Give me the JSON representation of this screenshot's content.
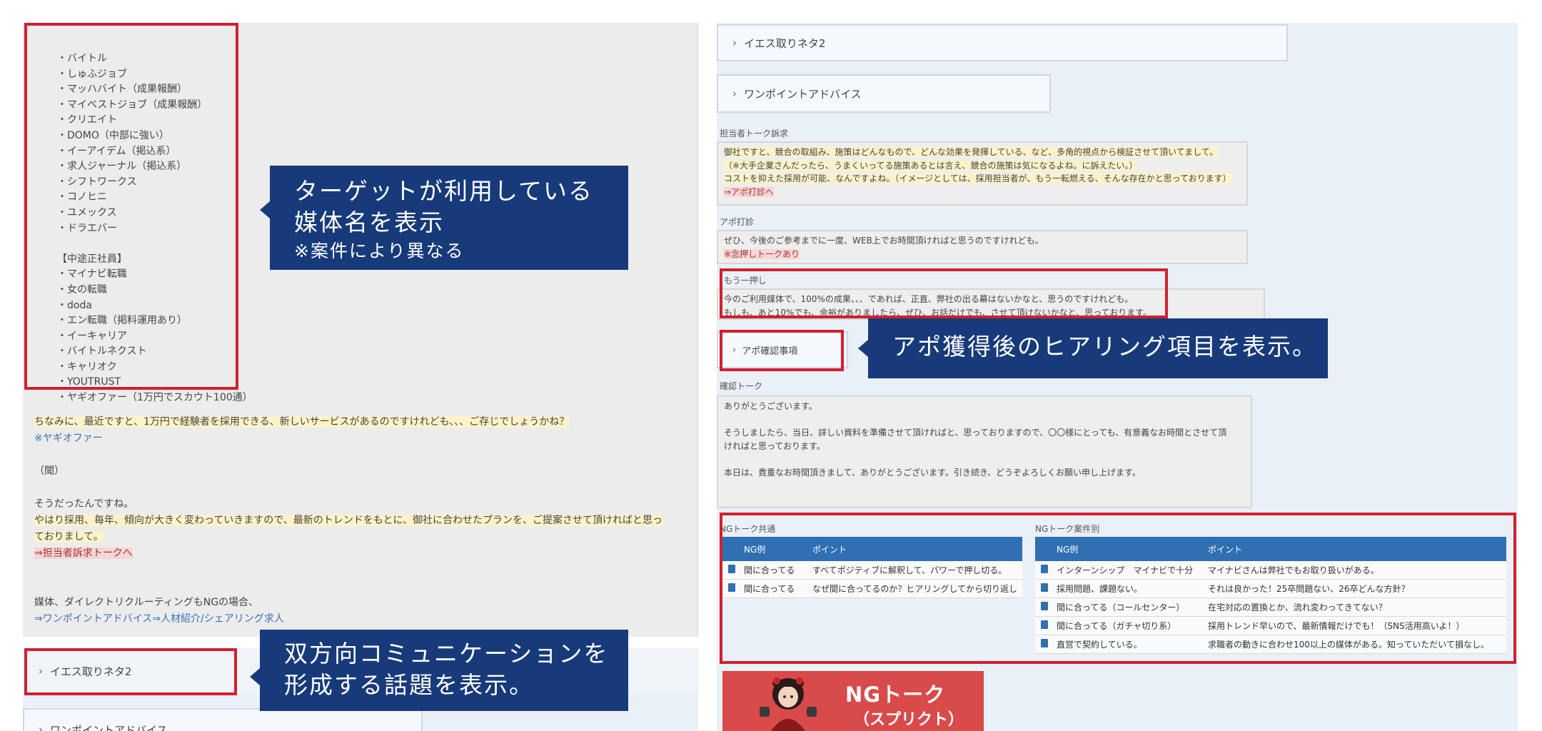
{
  "left": {
    "media_items": [
      "・バイトル",
      "・しゅふジョブ",
      "・マッハバイト（成果報酬）",
      "・マイベストジョブ（成果報酬）",
      "・クリエイト",
      "・DOMO（中部に強い）",
      "・イーアイデム（掲込系）",
      "・求人ジャーナル（掲込系）",
      "・シフトワークス",
      "・コノヒニ",
      "・ユメックス",
      "・ドラエバー",
      "",
      "【中途正社員】",
      "・マイナビ転職",
      "・女の転職",
      "・doda",
      "・エン転職（掲料運用あり）",
      "・イーキャリア",
      "・バイトルネクスト",
      "・キャリオク",
      "・YOUTRUST",
      "・ヤギオファー（1万円でスカウト100通）"
    ],
    "lines": [
      {
        "text": "ちなみに、最近ですと、1万円で経験者を採用できる、新しいサービスがあるのですけれども、、、ご存じでしょうかね？",
        "style": "hl"
      },
      {
        "text": "※ヤギオファー",
        "style": "blue-link"
      },
      {
        "text": "",
        "style": ""
      },
      {
        "text": "（聞）",
        "style": ""
      },
      {
        "text": "",
        "style": ""
      },
      {
        "text": "そうだったんですね。",
        "style": ""
      },
      {
        "text": "やはり採用、毎年、傾向が大きく変わっていきますので、最新のトレンドをもとに、御社に合わせたプランを、ご提案させて頂ければと思っ",
        "style": "hl"
      },
      {
        "text": "ておりまして。",
        "style": "hl"
      },
      {
        "text": "⇒担当者訴求トークへ",
        "style": "pink"
      },
      {
        "text": "",
        "style": ""
      },
      {
        "text": "",
        "style": ""
      },
      {
        "text": "媒体、ダイレクトリクルーティングもNGの場合、",
        "style": ""
      },
      {
        "text": "⇒ワンポイントアドバイス⇒人材紹介/シェアリング求人",
        "style": "blue-link"
      }
    ],
    "yes_topic": "イエス取りネタ2",
    "one_point": "ワンポイントアドバイス"
  },
  "callouts": {
    "media": {
      "line1": "ターゲットが利用している",
      "line2": "媒体名を表示",
      "note": "※案件により異なる"
    },
    "topic": {
      "line1": "双方向コミュニケーションを",
      "line2": "形成する話題を表示。"
    },
    "hearing": {
      "text": "アポ獲得後のヒアリング項目を表示。"
    }
  },
  "right": {
    "yes_topic": "イエス取りネタ2",
    "one_point": "ワンポイントアドバイス",
    "section1_label": "担当者トーク訴求",
    "section1_lines": [
      {
        "text": "御社ですと、競合の取組み、施策はどんなもので、どんな効果を発揮している、など、多角的視点から検証させて頂いてまして。",
        "style": "hl"
      },
      {
        "text": "（※大手企業さんだったら、うまくいってる施策あるとは言え、競合の施策は気になるよね。に訴えたい。）",
        "style": "hl"
      },
      {
        "text": "コストを抑えた採用が可能、なんですよね。（イメージとしては、採用担当者が、もう一転燃える、そんな存在かと思っております）",
        "style": "hl"
      },
      {
        "text": "⇒アポ打診へ",
        "style": "pink"
      }
    ],
    "section2_label": "アポ打診",
    "section2_lines": [
      {
        "text": "ぜひ、今後のご参考までに一度、WEB上でお時間頂ければと思うのですけれども。",
        "style": ""
      },
      {
        "text": "※念押しトークあり",
        "style": "pink"
      }
    ],
    "push_label": "もう一押し",
    "push_lines": [
      {
        "text": "今のご利用媒体で、100%の成果、、、であれば、正直、弊社の出る幕はないかなと、思うのですけれども。",
        "style": ""
      },
      {
        "text": "もしも、あと10%でも、余裕がありましたら、ぜひ、お話だけでも、させて頂けないかなと、思っております。",
        "style": ""
      }
    ],
    "confirm_item": "アポ確認事項",
    "confirm_label": "確認トーク",
    "confirm_lines": [
      {
        "text": "ありがとうございます。",
        "style": ""
      },
      {
        "text": "",
        "style": ""
      },
      {
        "text": "そうしましたら、当日、詳しい資料を準備させて頂ければと、思っておりますので、〇〇様にとっても、有意義なお時間とさせて頂",
        "style": ""
      },
      {
        "text": "ければと思っております。",
        "style": ""
      },
      {
        "text": "",
        "style": ""
      },
      {
        "text": "本日は、貴重なお時間頂きまして、ありがとうございます。引き続き、どうぞよろしくお願い申し上げます。",
        "style": ""
      }
    ],
    "ng_common": {
      "label": "NGトーク共通",
      "headers": [
        "NG例",
        "ポイント"
      ],
      "rows": [
        [
          "間に合ってる",
          "すべてポジティブに解釈して、パワーで押し切る。"
        ],
        [
          "間に合ってる",
          "なぜ間に合ってるのか？ヒアリングしてから切り返し"
        ]
      ]
    },
    "ng_case": {
      "label": "NGトーク案件別",
      "headers": [
        "NG例",
        "ポイント"
      ],
      "rows": [
        [
          "インターンシップ　マイナビで十分",
          "マイナビさんは弊社でもお取り扱いがある。"
        ],
        [
          "採用問題、課題ない。",
          "それは良かった！25卒問題ない、26卒どんな方針？"
        ],
        [
          "間に合ってる（コールセンター）",
          "在宅対応の置換とか、流れ変わってきてない？"
        ],
        [
          "間に合ってる（ガチャ切り系）",
          "採用トレンド早いので、最新情報だけでも！（SNS活用高いよ！）"
        ],
        [
          "直営で契約している。",
          "求職者の動きに合わせ100以上の媒体がある。知っていただいて損なし。"
        ]
      ]
    }
  },
  "banner": {
    "title": "NGトーク",
    "subtitle": "（スプリクト）"
  },
  "colors": {
    "accent": "#173a7a",
    "frame": "#d1202f",
    "table_header": "#2f6fb2",
    "banner": "#d94a4a"
  }
}
